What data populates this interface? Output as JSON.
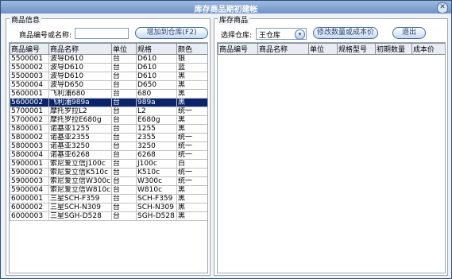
{
  "window": {
    "title": "库存商品期初建帐",
    "close_symbol": "✕"
  },
  "left_panel": {
    "legend": "商品信息",
    "search_label": "商品编号或名称:",
    "search_value": "",
    "add_button": "增加到仓库(F2)",
    "columns": [
      "商品编号",
      "商品名称",
      "单位",
      "规格",
      "颜色"
    ],
    "rows": [
      [
        "5500001",
        "波导D610",
        "台",
        "D610",
        "银"
      ],
      [
        "5500002",
        "波导D610",
        "台",
        "D610",
        "蓝"
      ],
      [
        "5500003",
        "波导D610",
        "台",
        "D610",
        "黑"
      ],
      [
        "5500004",
        "波导D650",
        "台",
        "D650",
        "黑"
      ],
      [
        "5600001",
        "飞利浦680",
        "台",
        "680",
        "黑"
      ],
      [
        "5600002",
        "飞利浦989a",
        "台",
        "989a",
        "黑"
      ],
      [
        "5700001",
        "摩托罗拉L2",
        "台",
        "L2",
        "统一"
      ],
      [
        "5700002",
        "摩托罗拉E680g",
        "台",
        "E680g",
        "黑"
      ],
      [
        "5800001",
        "诺基亚1255",
        "台",
        "1255",
        "黑"
      ],
      [
        "5800002",
        "诺基亚2355",
        "台",
        "2355",
        "统一"
      ],
      [
        "5800003",
        "诺基亚3250",
        "台",
        "3250",
        "统一"
      ],
      [
        "5800004",
        "诺基亚6268",
        "台",
        "6268",
        "统一"
      ],
      [
        "5900001",
        "索尼爱立信J100c",
        "台",
        "J100c",
        "白"
      ],
      [
        "5900002",
        "索尼爱立信K510c",
        "台",
        "K510c",
        "统一"
      ],
      [
        "5900003",
        "索尼爱立信W300c",
        "台",
        "W300c",
        "统一"
      ],
      [
        "5900004",
        "索尼爱立信W810c",
        "台",
        "W810c",
        "黑"
      ],
      [
        "6000001",
        "三星SCH-F359",
        "台",
        "SCH-F359",
        "黑"
      ],
      [
        "6000002",
        "三星SCH-N309",
        "台",
        "SCH-N309",
        "黑"
      ],
      [
        "6000003",
        "三星SGH-D528",
        "台",
        "SGH-D528",
        "黑"
      ]
    ],
    "selected_row": 5
  },
  "right_panel": {
    "legend": "库存商品",
    "warehouse_label": "选择仓库:",
    "warehouse_value": "王仓库",
    "arrow_symbol": "▾",
    "qty_cost_button": "修改数量或成本价",
    "exit_button": "退出",
    "columns": [
      "商品编号",
      "商品名称",
      "单位",
      "规格型号",
      "初期数量",
      "成本价"
    ],
    "rows": []
  }
}
